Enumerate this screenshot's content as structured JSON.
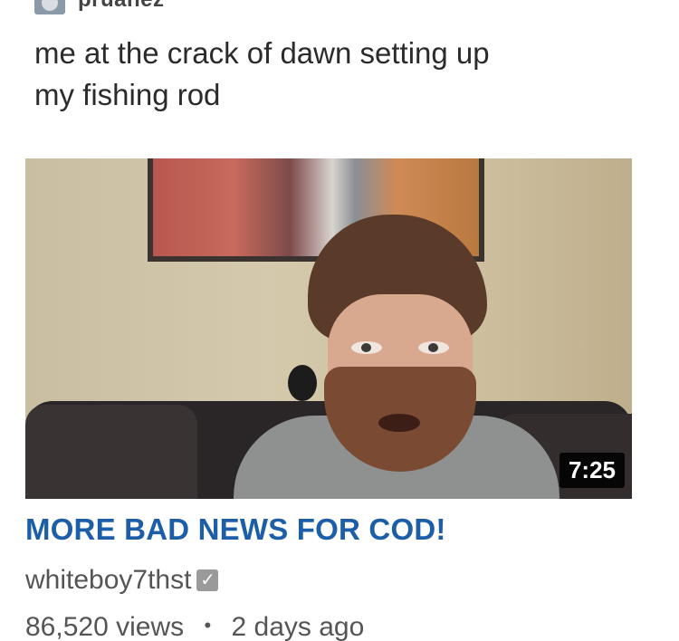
{
  "post": {
    "username": "pruanez",
    "caption_lines": [
      "me at the crack of dawn setting up",
      "my fishing rod"
    ]
  },
  "video": {
    "duration": "7:25",
    "title": "MORE BAD NEWS FOR COD!",
    "channel": "whiteboy7thst",
    "verified_icon": "check-icon",
    "views": "86,520 views",
    "separator": "•",
    "age": "2 days ago"
  },
  "colors": {
    "title": "#1c5ea8",
    "meta": "#555555",
    "caption": "#2b2b2b"
  }
}
